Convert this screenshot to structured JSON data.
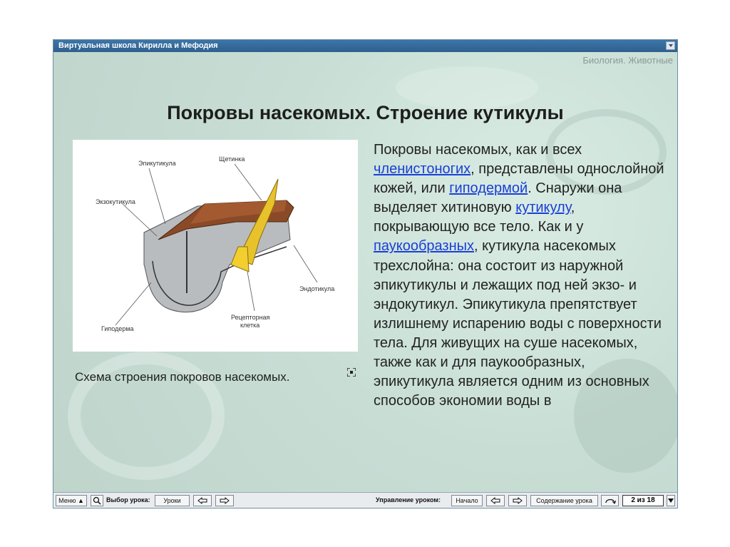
{
  "window": {
    "title": "Виртуальная школа Кирилла и Мефодия",
    "subject": "Биология. Животные"
  },
  "slide": {
    "heading": "Покровы насекомых. Строение кутикулы",
    "figure_labels": {
      "epicuticle": "Эпикутикула",
      "bristle": "Щетинка",
      "exocuticle": "Экзокутикула",
      "endocuticle": "Эндотикула",
      "receptor_line1": "Рецепторная",
      "receptor_line2": "клетка",
      "hypodermis": "Гиподерма"
    },
    "caption": "Схема строения покровов насекомых.",
    "text": {
      "p1": "Покровы насекомых, как и всех ",
      "link1": "членистоногих",
      "p2": ", представлены однослойной кожей, или ",
      "link2": "гиподермой",
      "p3": ". Снаружи она выделяет хитиновую ",
      "link3": "кутикулу",
      "p4": ", покрывающую все тело. Как и у ",
      "link4": "паукообразных",
      "p5": ", кутикула насекомых трехслойна: она состоит из наружной эпикутикулы и лежащих под ней экзо- и эндокутикул. Эпикутикула препятствует излишнему испарению воды с поверхности тела. Для живущих на суше насекомых, также как и для паукообразных, эпикутикула является одним из основных способов экономии воды в"
    }
  },
  "navbar": {
    "menu": "Меню",
    "choose_lesson": "Выбор урока:",
    "lessons": "Уроки",
    "lesson_control": "Управление уроком:",
    "start": "Начало",
    "contents": "Содержание урока",
    "page_counter": "2 из 18"
  },
  "colors": {
    "titlebar": "#2f5f8e",
    "background": "#c8ded5",
    "link": "#1a3fd6"
  }
}
